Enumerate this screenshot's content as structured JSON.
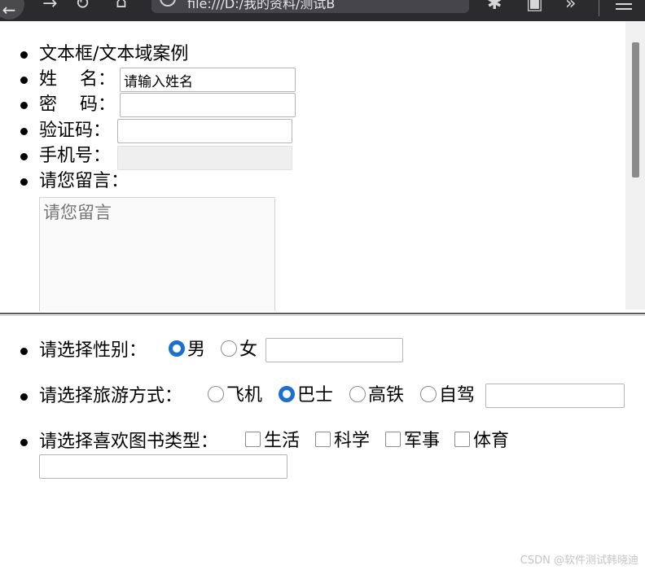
{
  "browser": {
    "address_text": "file:///D:/我的资料/测试B"
  },
  "top_frame": {
    "title": "文本框/文本域案例",
    "name_label": "姓    名：",
    "name_value": "请输入姓名",
    "password_label": "密    码：",
    "captcha_label": "验证码：",
    "phone_label": "手机号：",
    "message_label": "请您留言：",
    "message_placeholder": "请您留言"
  },
  "bottom_frame": {
    "gender": {
      "label": "请选择性别：",
      "options": [
        "男",
        "女"
      ],
      "selected": "男"
    },
    "travel": {
      "label": "请选择旅游方式：",
      "options": [
        "飞机",
        "巴士",
        "高铁",
        "自驾"
      ],
      "selected": "巴士"
    },
    "books": {
      "label": "请选择喜欢图书类型：",
      "options": [
        "生活",
        "科学",
        "军事",
        "体育"
      ]
    }
  },
  "watermark": "CSDN @软件测试韩晓迪",
  "colors": {
    "radio_selected": "#1a6fd0",
    "chrome_bg": "#2b2b2d"
  }
}
